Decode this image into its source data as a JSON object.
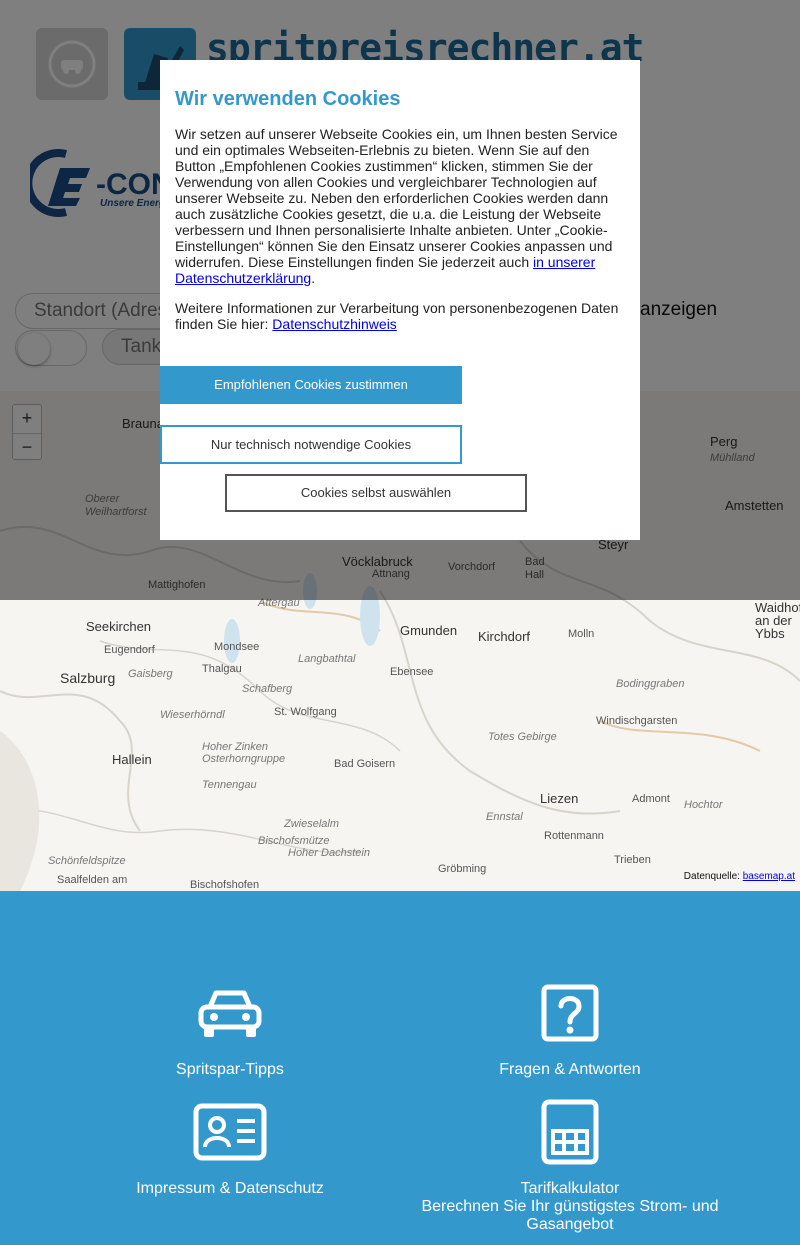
{
  "header": {
    "brand": "spritpreisrechner.at",
    "econtrol_logo": "E-CONTROL",
    "econtrol_tagline": "Unsere Energie"
  },
  "search": {
    "address_placeholder": "Standort (Adresse)",
    "type_label": "Tankstellen",
    "show_label": "anzeigen"
  },
  "map": {
    "zoom_in": "+",
    "zoom_out": "−",
    "labels": {
      "braunau": "Braunau",
      "oberer_weilhart": "Oberer Weilhartforst",
      "mattighofen": "Mattighofen",
      "voecklabruck": "Vöcklabruck",
      "attnang": "Attnang",
      "vorchdorf": "Vorchdorf",
      "bad_hall": "Bad Hall",
      "steyr": "Steyr",
      "perg": "Perg",
      "muehlland": "Mühlland",
      "amstetten": "Amstetten",
      "seekirchen": "Seekirchen",
      "eugendorf": "Eugendorf",
      "salzburg": "Salzburg",
      "gaisberg": "Gaisberg",
      "thalgau": "Thalgau",
      "mondsee": "Mondsee",
      "attergau": "Attergau",
      "gmunden": "Gmunden",
      "kirchdorf": "Kirchdorf",
      "molln": "Molln",
      "langbathtal": "Langbathtal",
      "schafberg": "Schafberg",
      "ebensee": "Ebensee",
      "bodinggraben": "Bodinggraben",
      "hallein": "Hallein",
      "wieserhoerndl": "Wieserhörndl",
      "st_wolfgang": "St. Wolfgang",
      "hoher_zinken": "Hoher Zinken",
      "osterhorngruppe": "Osterhorngruppe",
      "totes_gebirge": "Totes Gebirge",
      "windischgarsten": "Windischgarsten",
      "bad_goisern": "Bad Goisern",
      "tennengau": "Tennengau",
      "liezen": "Liezen",
      "admont": "Admont",
      "hochtor": "Hochtor",
      "zwieselalm": "Zwieselalm",
      "ennstal": "Ennstal",
      "rottenmann": "Rottenmann",
      "bischofsmuetze": "Bischofsmütze",
      "hoher_dachstein": "Hoher Dachstein",
      "schoenfeldspitze": "Schönfeldspitze",
      "saalfelden": "Saalfelden am",
      "bischofshofen": "Bischofshofen",
      "groebming": "Gröbming",
      "trieben": "Trieben",
      "waidhofen": "Waidhofen an der Ybbs"
    },
    "attribution_prefix": "Datenquelle:",
    "attribution_link": "basemap.at"
  },
  "cookie_dialog": {
    "title": "Wir verwenden Cookies",
    "body": "Wir setzen auf unserer Webseite Cookies ein, um Ihnen besten Service und ein optimales Webseiten-Erlebnis zu bieten. Wenn Sie auf den Button „Empfohlenen Cookies zustimmen“ klicken, stimmen Sie der Verwendung von allen Cookies und vergleichbarer Technologien auf unserer Webseite zu. Neben den erforderlichen Cookies werden dann auch zusätzliche Cookies gesetzt, die u.a. die Leistung der Webseite verbessern und Ihnen personalisierte Inhalte anbieten. Unter „Cookie-Einstellungen“ können Sie den Einsatz unserer Cookies anpassen und widerrufen. Diese Einstellungen finden Sie jederzeit auch ",
    "privacy_link": "in unserer Datenschutzerklärung",
    "body_end": ".",
    "more_info": "Weitere Informationen zur Verarbeitung von personenbezogenen Daten finden Sie hier: ",
    "more_info_link": "Datenschutzhinweis",
    "accept_button": "Empfohlenen Cookies zustimmen",
    "technical_button": "Nur technisch notwendige Cookies",
    "custom_button": "Cookies selbst auswählen"
  },
  "footer": {
    "tips": "Spritspar-Tipps",
    "faq": "Fragen & Antworten",
    "imprint": "Impressum & Datenschutz",
    "tariff_title": "Tarifkalkulator",
    "tariff_subtitle": "Berechnen Sie Ihr günstigstes Strom- und Gasangebot"
  },
  "colors": {
    "accent": "#3399cc",
    "brand_dark": "#1d6a96",
    "econtrol": "#1b4d86"
  }
}
